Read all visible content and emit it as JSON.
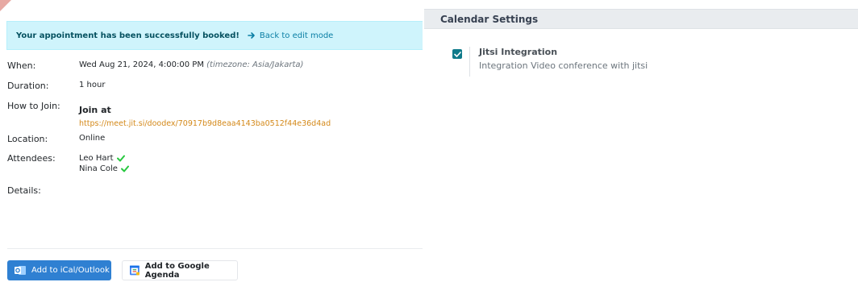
{
  "alert": {
    "message": "Your appointment has been successfully booked!",
    "back_link": "Back to edit mode"
  },
  "details": {
    "when": {
      "label": "When:",
      "value": "Wed Aug 21, 2024, 4:00:00 PM",
      "timezone": "(timezone: Asia/Jakarta)"
    },
    "duration": {
      "label": "Duration:",
      "value": "1 hour"
    },
    "how_to_join": {
      "label": "How to Join:",
      "title": "Join at",
      "url": "https://meet.jit.si/doodex/70917b9d8eaa4143ba0512f44e36d4ad"
    },
    "location": {
      "label": "Location:",
      "value": "Online"
    },
    "attendees": {
      "label": "Attendees:",
      "list": [
        "Leo Hart",
        "Nina Cole"
      ]
    },
    "details": {
      "label": "Details:"
    }
  },
  "buttons": {
    "ical": "Add to iCal/Outlook",
    "google": "Add to Google Agenda"
  },
  "settings": {
    "header": "Calendar Settings",
    "item_title": "Jitsi Integration",
    "item_desc": "Integration Video conference with jitsi",
    "checked": true
  },
  "colors": {
    "alert_bg": "#cff4fc",
    "link_orange": "#d4891a",
    "primary_blue": "#2f80d2",
    "checkbox_teal": "#0f7a8a",
    "check_green": "#28c840"
  }
}
